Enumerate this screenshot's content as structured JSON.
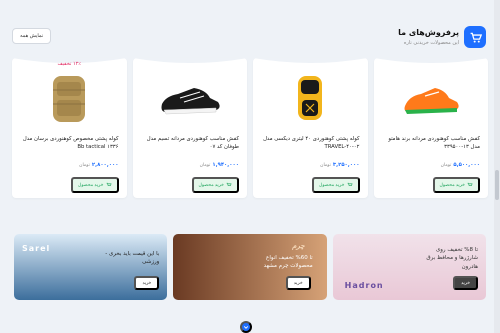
{
  "section": {
    "title": "پرفروش‌های ما",
    "subtitle": "این محصولات خریدنی تاره",
    "show_all": "نمایش همه"
  },
  "colors": {
    "accent": "#1e6fff",
    "discount": "#e0245e",
    "buy_bg": "#e4f7ea",
    "buy_fg": "#1aa35a"
  },
  "products": [
    {
      "title": "کفش مناسب کوهنوردی مردانه برند هامتو مدل ۱۳-۳۳۹۵۰۰",
      "price": "۵,۵۰۰,۰۰۰",
      "currency": "تومان",
      "buy": "خرید محصول",
      "discount": "",
      "image": "orange-sneaker"
    },
    {
      "title": "کوله پشتی کوهنوردی ۴۰ لیتری دیکسی مدل TRAVEL-۴۰-۰۲",
      "price": "۳,۲۵۰,۰۰۰",
      "currency": "تومان",
      "buy": "خرید محصول",
      "discount": "",
      "image": "yellow-backpack"
    },
    {
      "title": "کفش مناسب کوهنوردی مردانه تسیم مدل طوفان کد ۰۷",
      "price": "۱,۹۴۰,۰۰۰",
      "currency": "تومان",
      "buy": "خرید محصول",
      "discount": "",
      "image": "black-sneaker"
    },
    {
      "title": "کوله پشتی مخصوص کوهنوردی برسان مدل Bb tactical ۱۳۳۶",
      "price": "۲,۸۰۰,۰۰۰",
      "currency": "تومان",
      "buy": "خرید محصول",
      "discount": "۱۲٪ تخفیف",
      "image": "tan-backpack"
    }
  ],
  "banners": [
    {
      "text": "تا 8% تخفیف روی شارژرها و محافظ برق هادرون",
      "button": "خرید",
      "brand": "Hadron"
    },
    {
      "text": "تا 60% تخفیف انواع محصولات چرم مشهد",
      "button": "خرید",
      "brand": "چرم"
    },
    {
      "text": "با این قیمت باید بخری - ورزشی",
      "button": "خرید",
      "brand": "Sarel"
    }
  ]
}
